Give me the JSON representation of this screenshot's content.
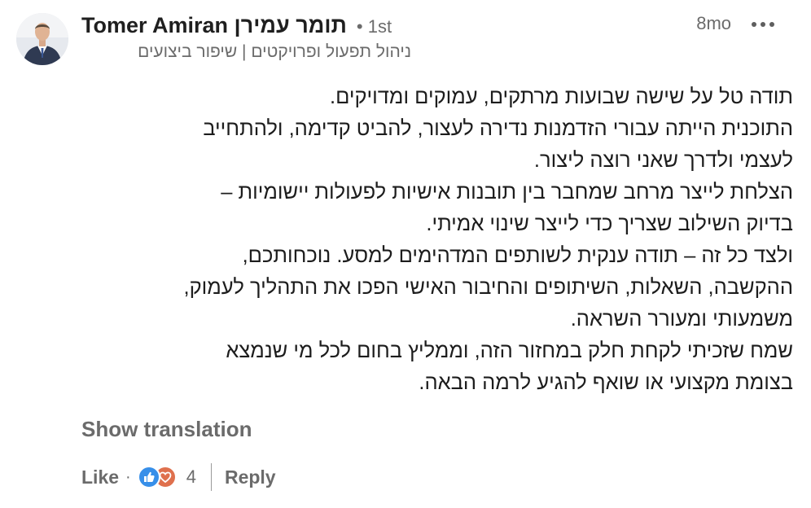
{
  "comment": {
    "author": {
      "name": "Tomer Amiran תומר עמירן",
      "degree": "• 1st",
      "headline": "ניהול תפעול ופרויקטים | שיפור ביצועים",
      "avatar_icon": "profile-photo"
    },
    "time": "8mo",
    "more_icon": "ellipsis-horizontal-icon",
    "body_lines": [
      "תודה טל על שישה שבועות מרתקים, עמוקים ומדויקים.",
      "התוכנית הייתה עבורי הזדמנות נדירה לעצור, להביט קדימה, ולהתחייב",
      "לעצמי ולדרך שאני רוצה ליצור.",
      "הצלחת לייצר מרחב שמחבר בין תובנות אישיות לפעולות יישומיות –",
      "בדיוק השילוב שצריך כדי לייצר שינוי אמיתי.",
      "ולצד כל זה – תודה ענקית לשותפים המדהימים למסע. נוכחותכם,",
      "ההקשבה, השאלות, השיתופים והחיבור האישי הפכו את התהליך לעמוק,",
      "משמעותי ומעורר השראה.",
      "שמח שזכיתי לקחת חלק במחזור הזה, וממליץ בחום לכל מי שנמצא",
      "בצומת מקצועי או שואף להגיע לרמה הבאה."
    ],
    "show_translation": "Show translation",
    "actions": {
      "like_label": "Like",
      "separator": "·",
      "reactions": {
        "icons": [
          "like-reaction-icon",
          "love-reaction-icon"
        ],
        "count": "4"
      },
      "reply_label": "Reply"
    }
  },
  "colors": {
    "text": "#1d1d1d",
    "muted": "#6b6b6b",
    "like_blue": "#378fe9",
    "love_orange": "#df704d"
  }
}
